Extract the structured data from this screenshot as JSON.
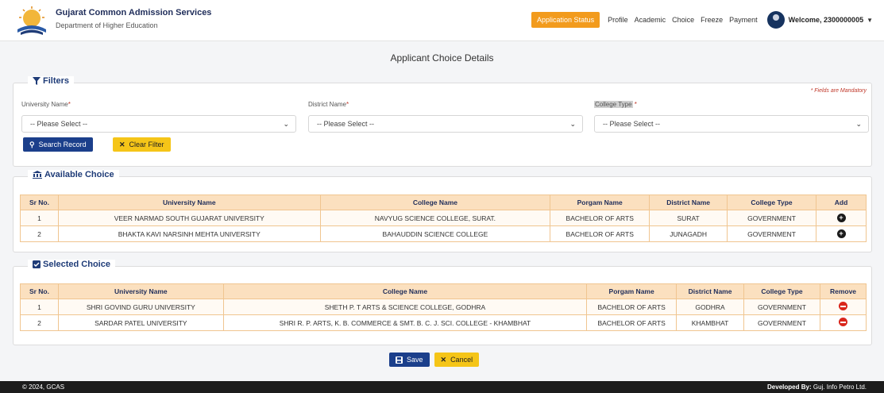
{
  "header": {
    "org_name": "Gujarat Common Admission Services",
    "dept_name": "Department of Higher Education",
    "nav": {
      "application_status": "Application Status",
      "profile": "Profile",
      "academic": "Academic",
      "choice": "Choice",
      "freeze": "Freeze",
      "payment": "Payment",
      "welcome": "Welcome, 2300000005"
    }
  },
  "page_title": "Applicant Choice Details",
  "filters": {
    "legend": "Filters",
    "mandatory_note": "* Fields are Mandatory",
    "university_label": "University Name",
    "district_label": "District Name",
    "college_type_label": "College Type",
    "required_mark": "*",
    "university_value": "-- Please Select --",
    "district_value": "-- Please Select --",
    "college_type_value": "-- Please Select --",
    "search_button": "Search Record",
    "clear_button": "Clear Filter"
  },
  "available": {
    "legend": "Available Choice",
    "headers": [
      "Sr No.",
      "University Name",
      "College Name",
      "Porgam Name",
      "District Name",
      "College Type",
      "Add"
    ],
    "rows": [
      [
        "1",
        "VEER NARMAD SOUTH GUJARAT UNIVERSITY",
        "NAVYUG SCIENCE COLLEGE, SURAT.",
        "BACHELOR OF ARTS",
        "SURAT",
        "GOVERNMENT"
      ],
      [
        "2",
        "BHAKTA KAVI NARSINH MEHTA UNIVERSITY",
        "BAHAUDDIN SCIENCE COLLEGE",
        "BACHELOR OF ARTS",
        "JUNAGADH",
        "GOVERNMENT"
      ]
    ]
  },
  "selected": {
    "legend": "Selected Choice",
    "headers": [
      "Sr No.",
      "University Name",
      "College Name",
      "Porgam Name",
      "District Name",
      "College Type",
      "Remove"
    ],
    "rows": [
      [
        "1",
        "SHRI GOVIND GURU UNIVERSITY",
        "SHETH P. T ARTS & SCIENCE COLLEGE, GODHRA",
        "BACHELOR OF ARTS",
        "GODHRA",
        "GOVERNMENT"
      ],
      [
        "2",
        "SARDAR PATEL UNIVERSITY",
        "SHRI R. P. ARTS, K. B. COMMERCE & SMT. B. C. J. SCI. COLLEGE - KHAMBHAT",
        "BACHELOR OF ARTS",
        "KHAMBHAT",
        "GOVERNMENT"
      ]
    ]
  },
  "actions": {
    "save": "Save",
    "cancel": "Cancel"
  },
  "footer": {
    "copyright": "© 2024, GCAS",
    "developed_by_label": "Developed By:",
    "developed_by_value": "Guj. Info Petro Ltd."
  },
  "colors": {
    "navy": "#1b3f8b",
    "orange": "#f29b1d",
    "yellow": "#f5c518",
    "table_header": "#fbe0bf",
    "remove_red": "#d9261c"
  }
}
